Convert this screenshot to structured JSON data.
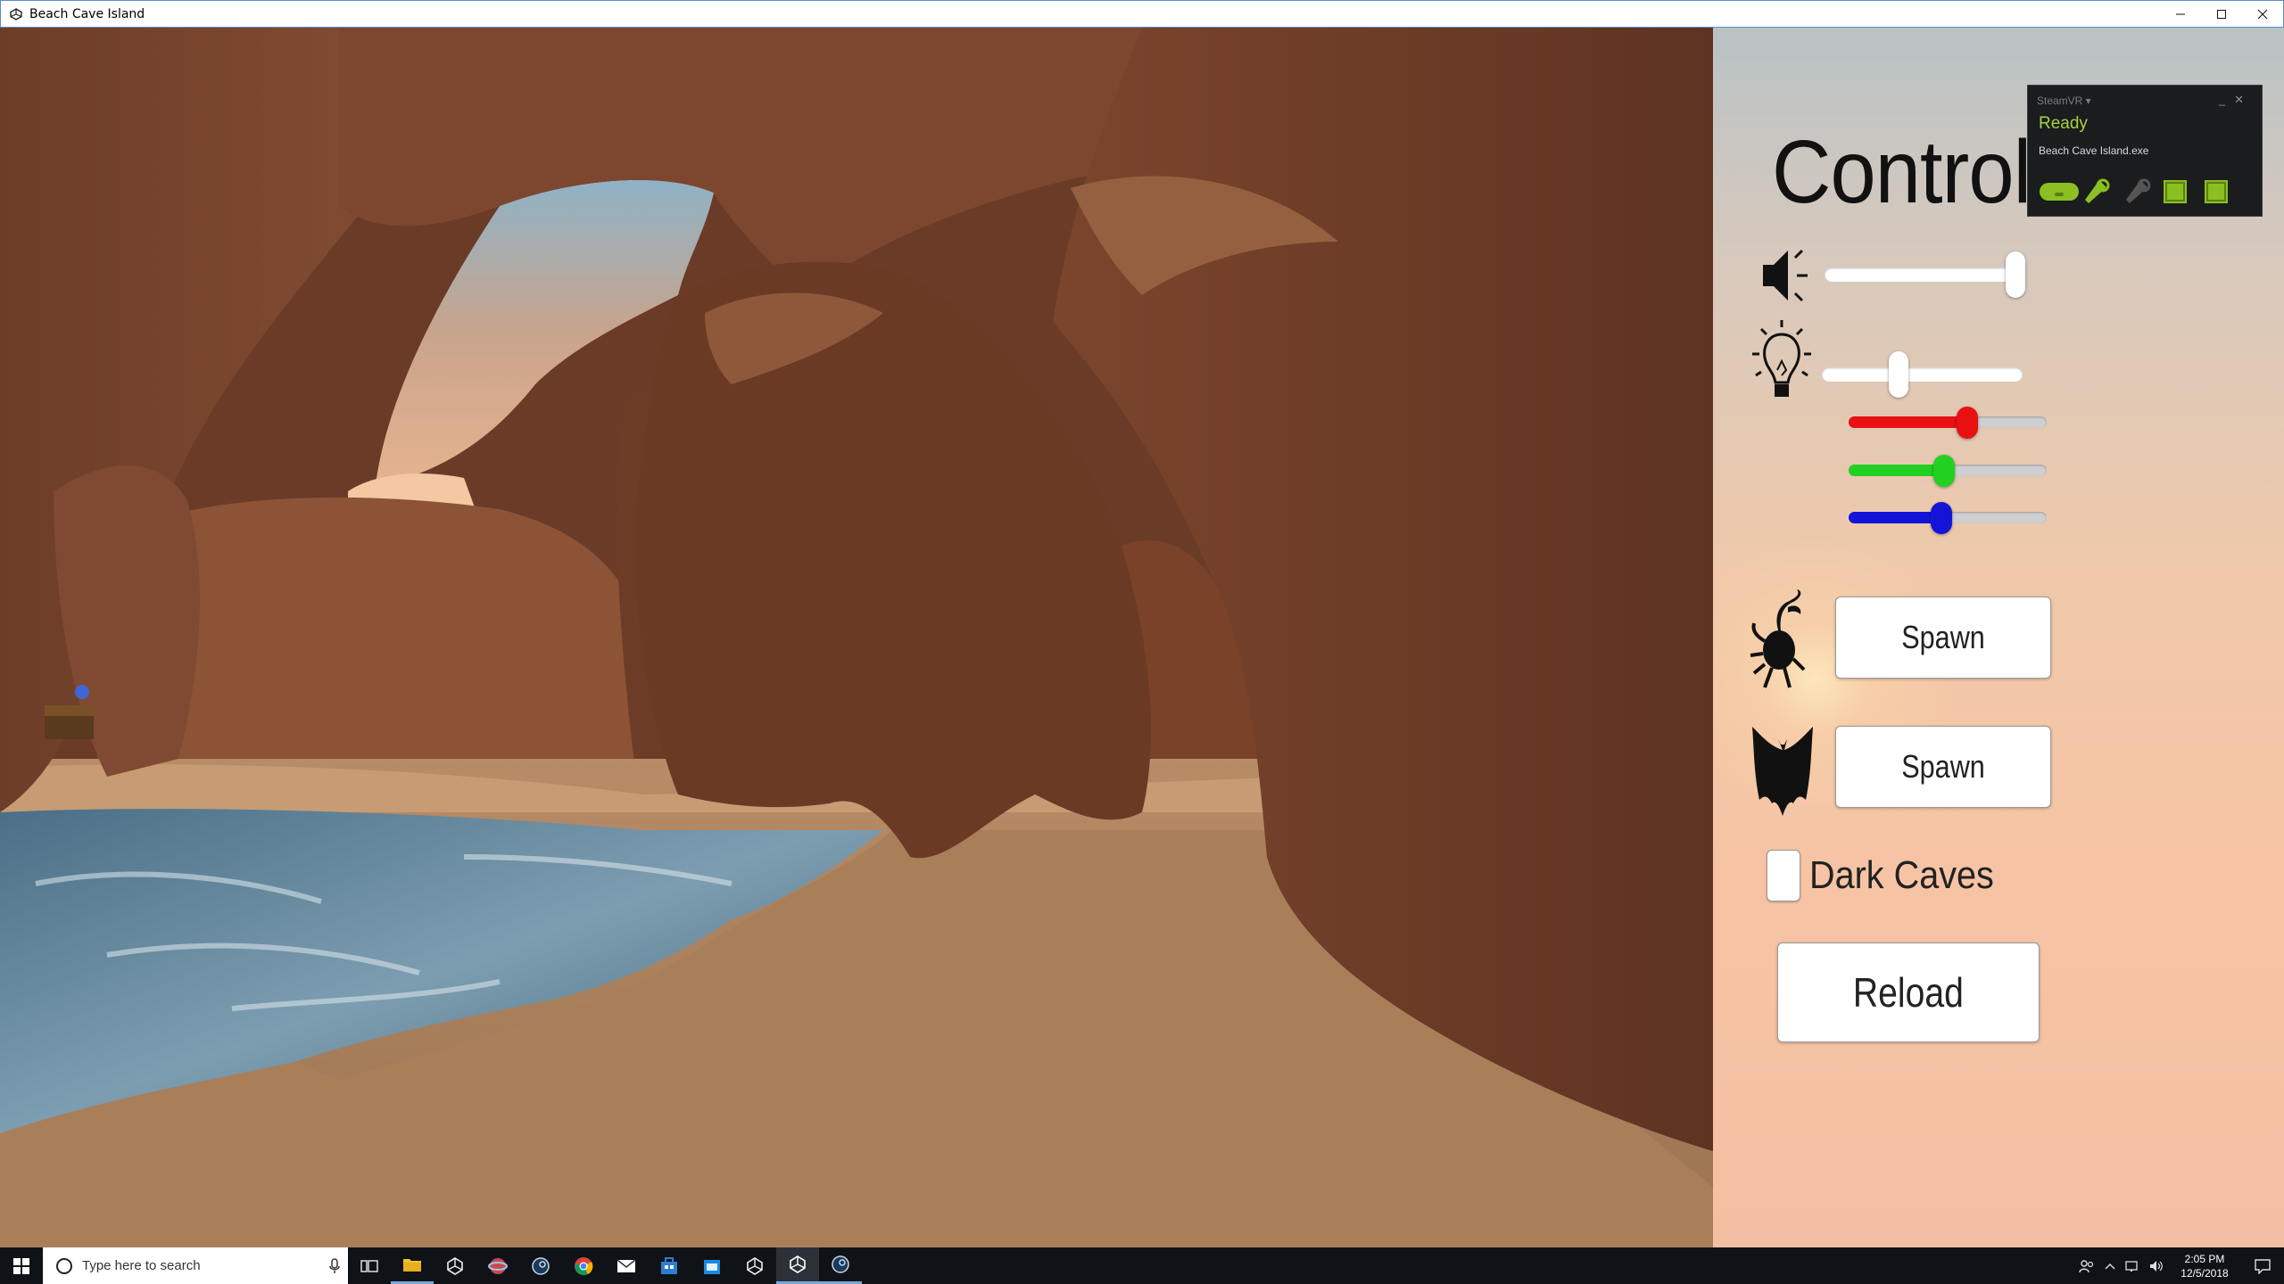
{
  "window": {
    "title": "Beach Cave Island",
    "buttons": [
      "minimize",
      "maximize",
      "close"
    ]
  },
  "controls_panel": {
    "title": "Controls",
    "volume": {
      "icon": "speaker-icon",
      "value_fraction": 0.95
    },
    "light": {
      "icon": "lightbulb-icon",
      "intensity_fraction": 0.38,
      "red_fraction": 0.6,
      "green_fraction": 0.48,
      "blue_fraction": 0.47,
      "colors": {
        "red": "#e81010",
        "green": "#22d022",
        "blue": "#1414d8"
      }
    },
    "spawn_crab": {
      "icon": "crab-icon",
      "label": "Spawn"
    },
    "spawn_bat": {
      "icon": "bat-icon",
      "label": "Spawn"
    },
    "dark_caves": {
      "label": "Dark Caves",
      "checked": false
    },
    "reload": {
      "label": "Reload"
    }
  },
  "steamvr": {
    "header": "SteamVR ▾",
    "status": "Ready",
    "app": "Beach Cave Island.exe",
    "status_color": "#a8d43a",
    "device_icons": [
      "headset-icon",
      "controller-icon",
      "controller-inactive-icon",
      "base-station-icon",
      "base-station-icon"
    ]
  },
  "taskbar": {
    "search_placeholder": "Type here to search",
    "apps": [
      "task-view-icon",
      "file-explorer-icon",
      "unity-icon",
      "app-icon",
      "steam-icon",
      "chrome-icon",
      "mail-icon",
      "store-icon",
      "store-icon",
      "unity-icon",
      "unity-active-icon",
      "steam-icon"
    ],
    "clock": {
      "time": "2:05 PM",
      "date": "12/5/2018"
    }
  }
}
